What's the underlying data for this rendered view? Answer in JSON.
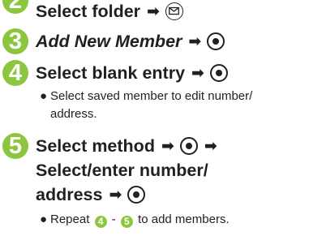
{
  "steps": [
    {
      "number": "2",
      "line1": "Select folder",
      "icon_after": "mail-key-icon"
    },
    {
      "number": "3",
      "line1": "Add New Member",
      "icon_after": "center-key-icon"
    },
    {
      "number": "4",
      "line1": "Select blank entry",
      "icon_after": "center-key-icon",
      "note_line1": "Select saved member to edit number/",
      "note_line2": "address."
    },
    {
      "number": "5",
      "line1": "Select method",
      "line2": "Select/enter number/",
      "line3": "address",
      "note_prefix": "Repeat",
      "note_from": "4",
      "note_dash": "-",
      "note_to": "5",
      "note_suffix": "to add members."
    }
  ],
  "colors": {
    "badge": "#8cc63f",
    "text": "#231f20"
  }
}
